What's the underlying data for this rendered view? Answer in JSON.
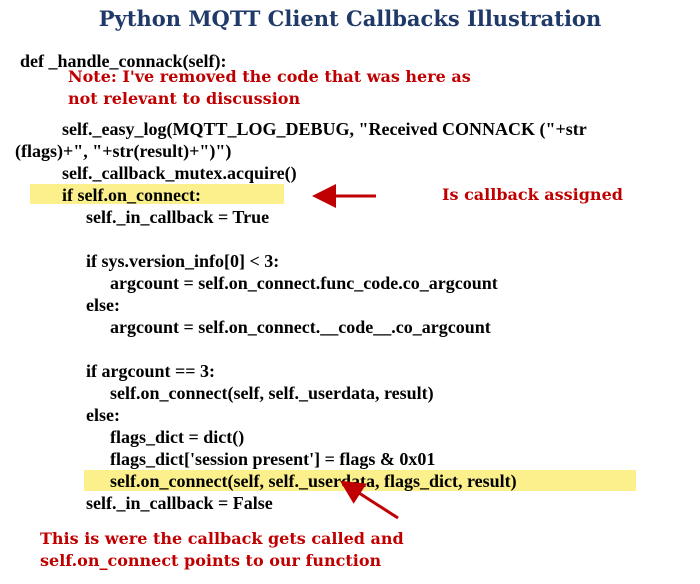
{
  "title": "Python MQTT Client Callbacks Illustration",
  "code_lines": [
    "def _handle_connack(self):",
    "self._easy_log(MQTT_LOG_DEBUG, \"Received CONNACK (\"+str",
    "(flags)+\", \"+str(result)+\")\")",
    "self._callback_mutex.acquire()",
    "if self.on_connect:",
    "self._in_callback = True",
    "if sys.version_info[0] < 3:",
    "argcount = self.on_connect.func_code.co_argcount",
    "else:",
    "argcount = self.on_connect.__code__.co_argcount",
    "if argcount == 3:",
    "self.on_connect(self, self._userdata, result)",
    "else:",
    "flags_dict = dict()",
    "flags_dict['session present'] = flags & 0x01",
    "self.on_connect(self, self._userdata, flags_dict, result)",
    "self._in_callback = False"
  ],
  "annotations": {
    "removed_note_line1": "Note: I've removed the code that was here as",
    "removed_note_line2": "not relevant to discussion",
    "callback_assigned": "Is callback assigned",
    "bottom_note_line1": "This is were the callback gets called and",
    "bottom_note_line2": "self.on_connect points to our function"
  },
  "colors": {
    "title": "#1f3a68",
    "annotation": "#c00000",
    "highlight": "#fcf08c",
    "code": "#000000"
  }
}
